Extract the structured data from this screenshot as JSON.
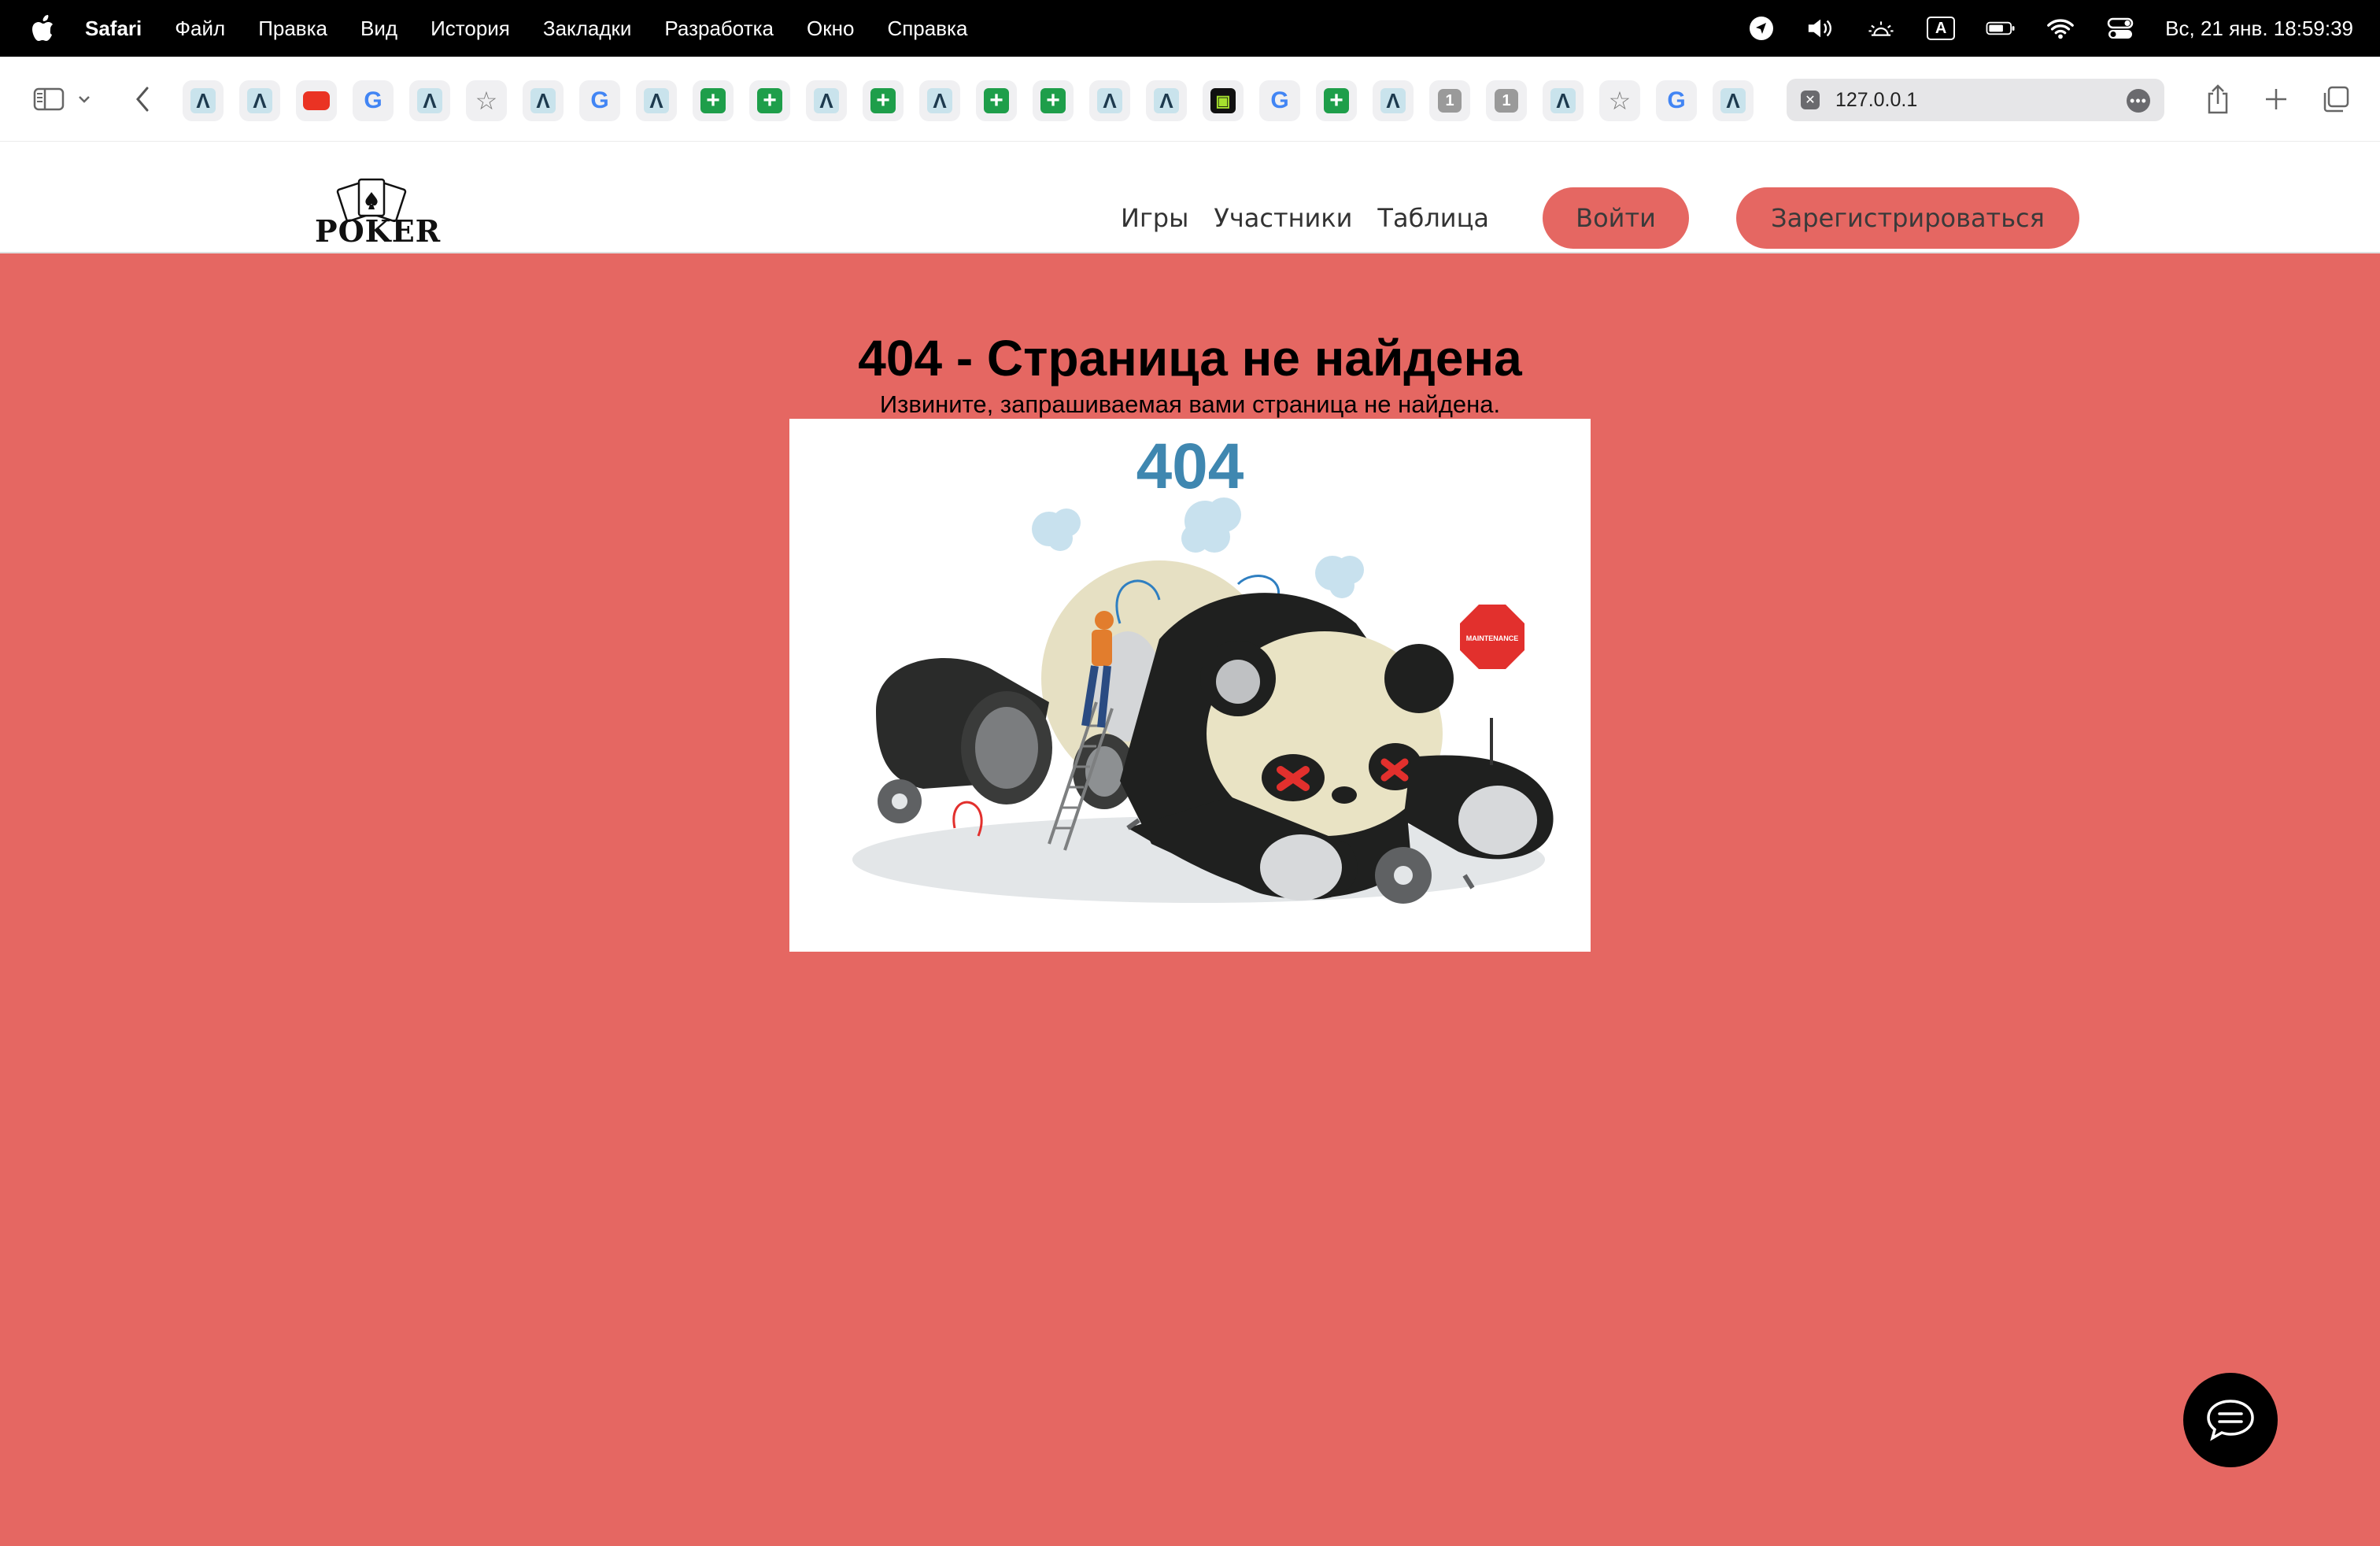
{
  "menubar": {
    "app_name": "Safari",
    "items": [
      "Файл",
      "Правка",
      "Вид",
      "История",
      "Закладки",
      "Разработка",
      "Окно",
      "Справка"
    ],
    "keyboard_layout": "A",
    "clock": "Вс, 21 янв.  18:59:39"
  },
  "browser": {
    "url": "127.0.0.1",
    "favorites": [
      {
        "icon": "lambda-icon",
        "glyph": "Λ"
      },
      {
        "icon": "lambda-icon",
        "glyph": "Λ"
      },
      {
        "icon": "youtube-icon",
        "glyph": ""
      },
      {
        "icon": "google-icon",
        "glyph": "G"
      },
      {
        "icon": "lambda-icon",
        "glyph": "Λ"
      },
      {
        "icon": "star-icon",
        "glyph": "☆"
      },
      {
        "icon": "lambda-icon",
        "glyph": "Λ"
      },
      {
        "icon": "google-icon",
        "glyph": "G"
      },
      {
        "icon": "lambda-icon",
        "glyph": "Λ"
      },
      {
        "icon": "sheets-icon",
        "glyph": "+"
      },
      {
        "icon": "sheets-icon",
        "glyph": "+"
      },
      {
        "icon": "lambda-icon",
        "glyph": "Λ"
      },
      {
        "icon": "sheets-icon",
        "glyph": "+"
      },
      {
        "icon": "lambda-icon",
        "glyph": "Λ"
      },
      {
        "icon": "sheets-icon",
        "glyph": "+"
      },
      {
        "icon": "sheets-icon",
        "glyph": "+"
      },
      {
        "icon": "lambda-icon",
        "glyph": "Λ"
      },
      {
        "icon": "lambda-icon",
        "glyph": "Λ"
      },
      {
        "icon": "game-icon",
        "glyph": "▣"
      },
      {
        "icon": "google-icon",
        "glyph": "G"
      },
      {
        "icon": "sheets-icon",
        "glyph": "+"
      },
      {
        "icon": "lambda-icon",
        "glyph": "Λ"
      },
      {
        "icon": "number-one-icon",
        "glyph": "1"
      },
      {
        "icon": "number-one-icon",
        "glyph": "1"
      },
      {
        "icon": "lambda-icon",
        "glyph": "Λ"
      },
      {
        "icon": "star-icon",
        "glyph": "☆"
      },
      {
        "icon": "google-icon",
        "glyph": "G"
      },
      {
        "icon": "lambda-icon",
        "glyph": "Λ"
      }
    ]
  },
  "site": {
    "logo_text": "POKER",
    "nav": [
      "Игры",
      "Участники",
      "Таблица"
    ],
    "login_label": "Войти",
    "register_label": "Зарегистрироваться"
  },
  "error": {
    "title": "404 - Страница не найдена",
    "message": "Извините, запрашиваемая вами страница не найдена.",
    "image_number": "404",
    "sign_text": "MAINTENANCE"
  },
  "colors": {
    "accent": "#e56762",
    "image_number": "#3f87b0"
  }
}
